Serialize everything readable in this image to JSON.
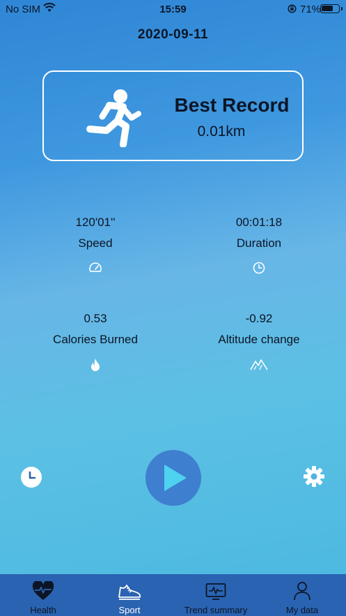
{
  "status_bar": {
    "carrier": "No SIM",
    "time": "15:59",
    "battery": "71%",
    "battery_level": 0.71
  },
  "header": {
    "date": "2020-09-11"
  },
  "best_record": {
    "title": "Best Record",
    "value": "0.01km"
  },
  "stats": [
    {
      "value": "120'01''",
      "label": "Speed",
      "icon": "speedometer-icon"
    },
    {
      "value": "00:01:18",
      "label": "Duration",
      "icon": "clock-icon"
    },
    {
      "value": "0.53",
      "label": "Calories Burned",
      "icon": "flame-icon"
    },
    {
      "value": "-0.92",
      "label": "Altitude change",
      "icon": "mountain-icon"
    }
  ],
  "controls": {
    "history_icon": "history-clock-icon",
    "play_icon": "play-icon",
    "settings_icon": "gear-icon"
  },
  "tabs": [
    {
      "label": "Health",
      "icon": "heart-pulse-icon"
    },
    {
      "label": "Sport",
      "icon": "sneaker-icon",
      "active": true
    },
    {
      "label": "Trend summary",
      "icon": "monitor-pulse-icon"
    },
    {
      "label": "My data",
      "icon": "person-icon"
    }
  ],
  "colors": {
    "tabbar": "#2a63b1",
    "play_button": "#3f7fcf",
    "text": "#0c1526"
  }
}
